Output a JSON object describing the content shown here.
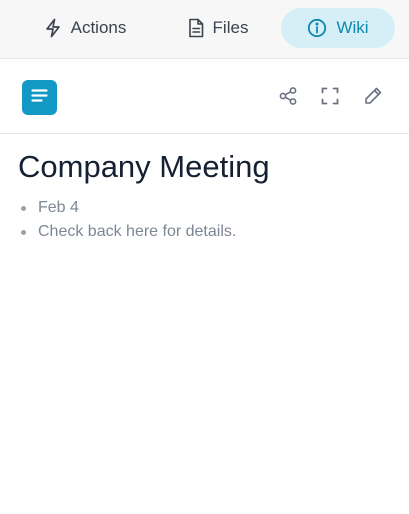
{
  "tabs": [
    {
      "label": "Actions",
      "icon": "lightning-icon",
      "active": false
    },
    {
      "label": "Files",
      "icon": "document-icon",
      "active": false
    },
    {
      "label": "Wiki",
      "icon": "info-circle-icon",
      "active": true
    }
  ],
  "toolbar": {
    "menu_icon": "hamburger-menu-icon",
    "actions": [
      {
        "name": "share",
        "icon": "share-icon"
      },
      {
        "name": "expand",
        "icon": "fullscreen-icon"
      },
      {
        "name": "edit",
        "icon": "pencil-icon"
      }
    ]
  },
  "document": {
    "title": "Company Meeting",
    "items": [
      "Feb 4",
      "Check back here for details."
    ]
  },
  "colors": {
    "accent": "#1299c3",
    "active_tab_bg": "#d6eef5",
    "active_tab_text": "#0d89ad",
    "title_text": "#152033",
    "muted_text": "#7d8794"
  }
}
